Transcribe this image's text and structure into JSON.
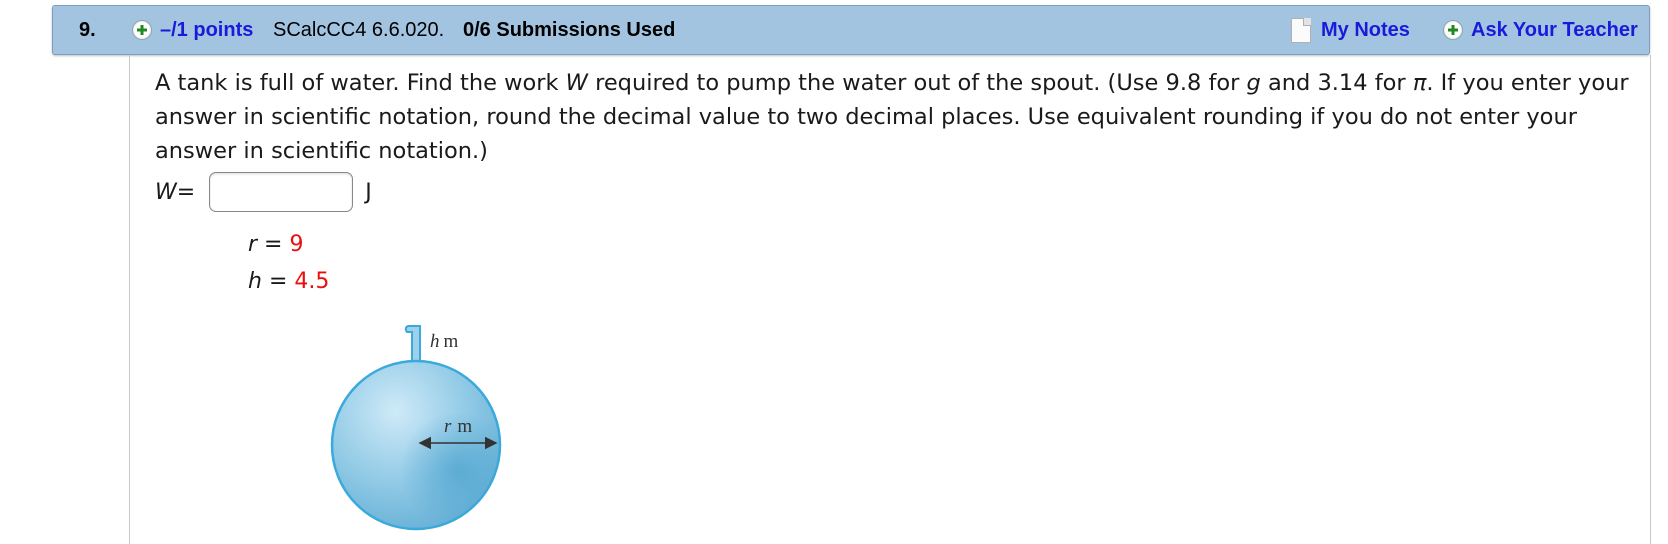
{
  "header": {
    "question_number": "9.",
    "points_link": "–/1 points",
    "problem_code": "SCalcCC4 6.6.020.",
    "submissions": "0/6 Submissions Used",
    "my_notes": "My Notes",
    "ask_teacher": "Ask Your Teacher"
  },
  "question": {
    "text_parts": [
      "A tank is full of water. Find the work ",
      "W",
      " required to pump the water out of the spout. (Use 9.8 for ",
      "g",
      " and 3.14 for ",
      "π",
      ". If you enter your answer in scientific notation, round the decimal value to two decimal places. Use equivalent rounding if you do not enter your answer in scientific notation.)"
    ]
  },
  "answer": {
    "label_var": "W",
    "label_eq": " =",
    "value": "",
    "unit": "J"
  },
  "givens": [
    {
      "var": "r",
      "eq": " = ",
      "value": "9"
    },
    {
      "var": "h",
      "eq": " = ",
      "value": "4.5"
    }
  ],
  "figure": {
    "spout_label_var": "h",
    "spout_label_unit": "m",
    "radius_label_var": "r",
    "radius_label_unit": "m"
  },
  "colors": {
    "header_bg": "#a3c4e0",
    "link": "#1a1adb",
    "given_value": "#e8100f",
    "tank_fill": "#8ec5e3",
    "tank_edge": "#3aa9db"
  }
}
